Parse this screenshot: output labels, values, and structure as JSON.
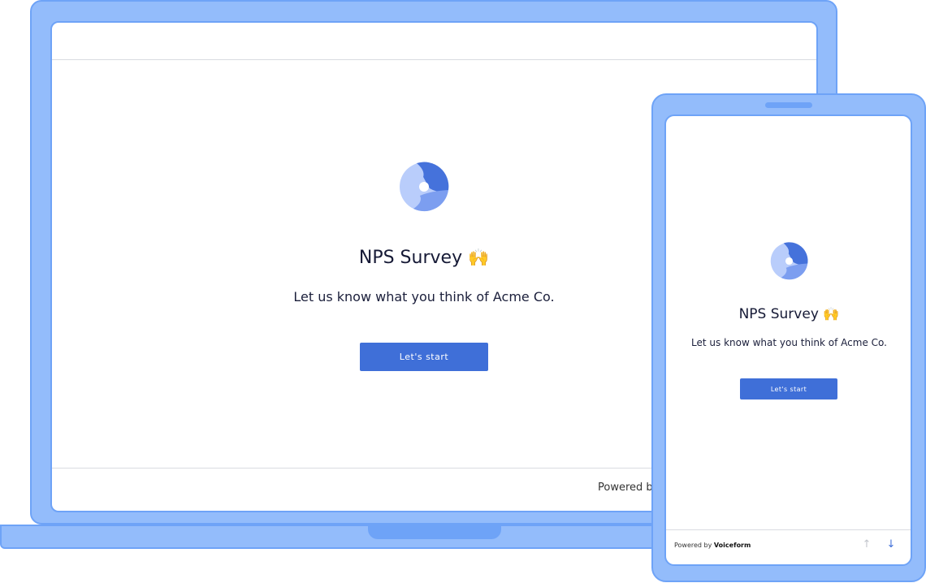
{
  "survey": {
    "title": "NPS Survey",
    "title_emoji": "🙌",
    "subtitle": "Let us know what you think of Acme Co.",
    "start_button_label": "Let's start",
    "logo_icon": "voiceform-logo-icon"
  },
  "laptop": {
    "footer_powered_text": "Powered b"
  },
  "phone": {
    "footer_powered_prefix": "Powered by",
    "footer_brand": "Voiceform",
    "nav_up_icon": "arrow-up-icon",
    "nav_down_icon": "arrow-down-icon"
  },
  "colors": {
    "device_fill": "#93bcfb",
    "device_border": "#6ea3f7",
    "button": "#3f6fd8",
    "logo_dark": "#4572db",
    "logo_mid": "#7c9ef0",
    "logo_light": "#b9cdfb"
  }
}
